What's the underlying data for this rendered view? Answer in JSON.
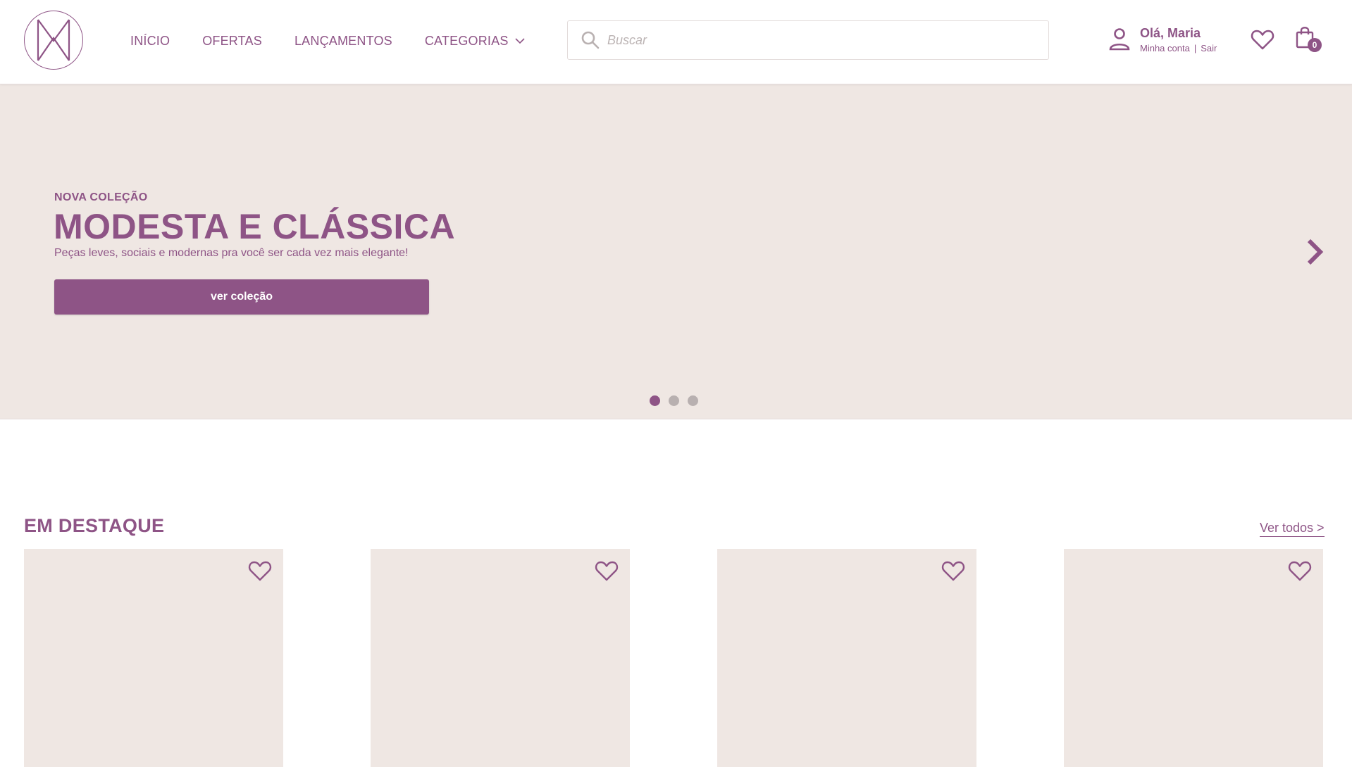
{
  "brand": {
    "accent_color": "#8e5486",
    "background_color": "#efe7e3",
    "logo_icon": "mm-monogram-icon"
  },
  "nav": {
    "items": [
      {
        "label": "INÍCIO"
      },
      {
        "label": "OFERTAS"
      },
      {
        "label": "LANÇAMENTOS"
      },
      {
        "label": "CATEGORIAS",
        "icon": "chevron-down-icon"
      }
    ]
  },
  "search": {
    "placeholder": "Buscar",
    "value": "",
    "icon": "search-icon"
  },
  "account": {
    "greeting": "Olá, Maria",
    "my_account": "Minha conta",
    "separator": "|",
    "logout": "Sair",
    "icon": "user-icon"
  },
  "wishlist": {
    "icon": "heart-icon"
  },
  "cart": {
    "count": "0",
    "icon": "shopping-bag-icon"
  },
  "hero": {
    "eyebrow": "NOVA COLEÇÃO",
    "title": "MODESTA E CLÁSSICA",
    "subtitle": "Peças leves, sociais e modernas pra você ser cada vez mais elegante!",
    "cta": "ver coleção",
    "next_icon": "chevron-right-icon",
    "slides": 3,
    "active_slide": 1
  },
  "featured": {
    "title": "EM DESTAQUE",
    "see_all": "Ver todos >",
    "products": [
      {
        "favorite_icon": "heart-outline-icon"
      },
      {
        "favorite_icon": "heart-outline-icon"
      },
      {
        "favorite_icon": "heart-outline-icon"
      },
      {
        "favorite_icon": "heart-outline-icon"
      }
    ]
  }
}
